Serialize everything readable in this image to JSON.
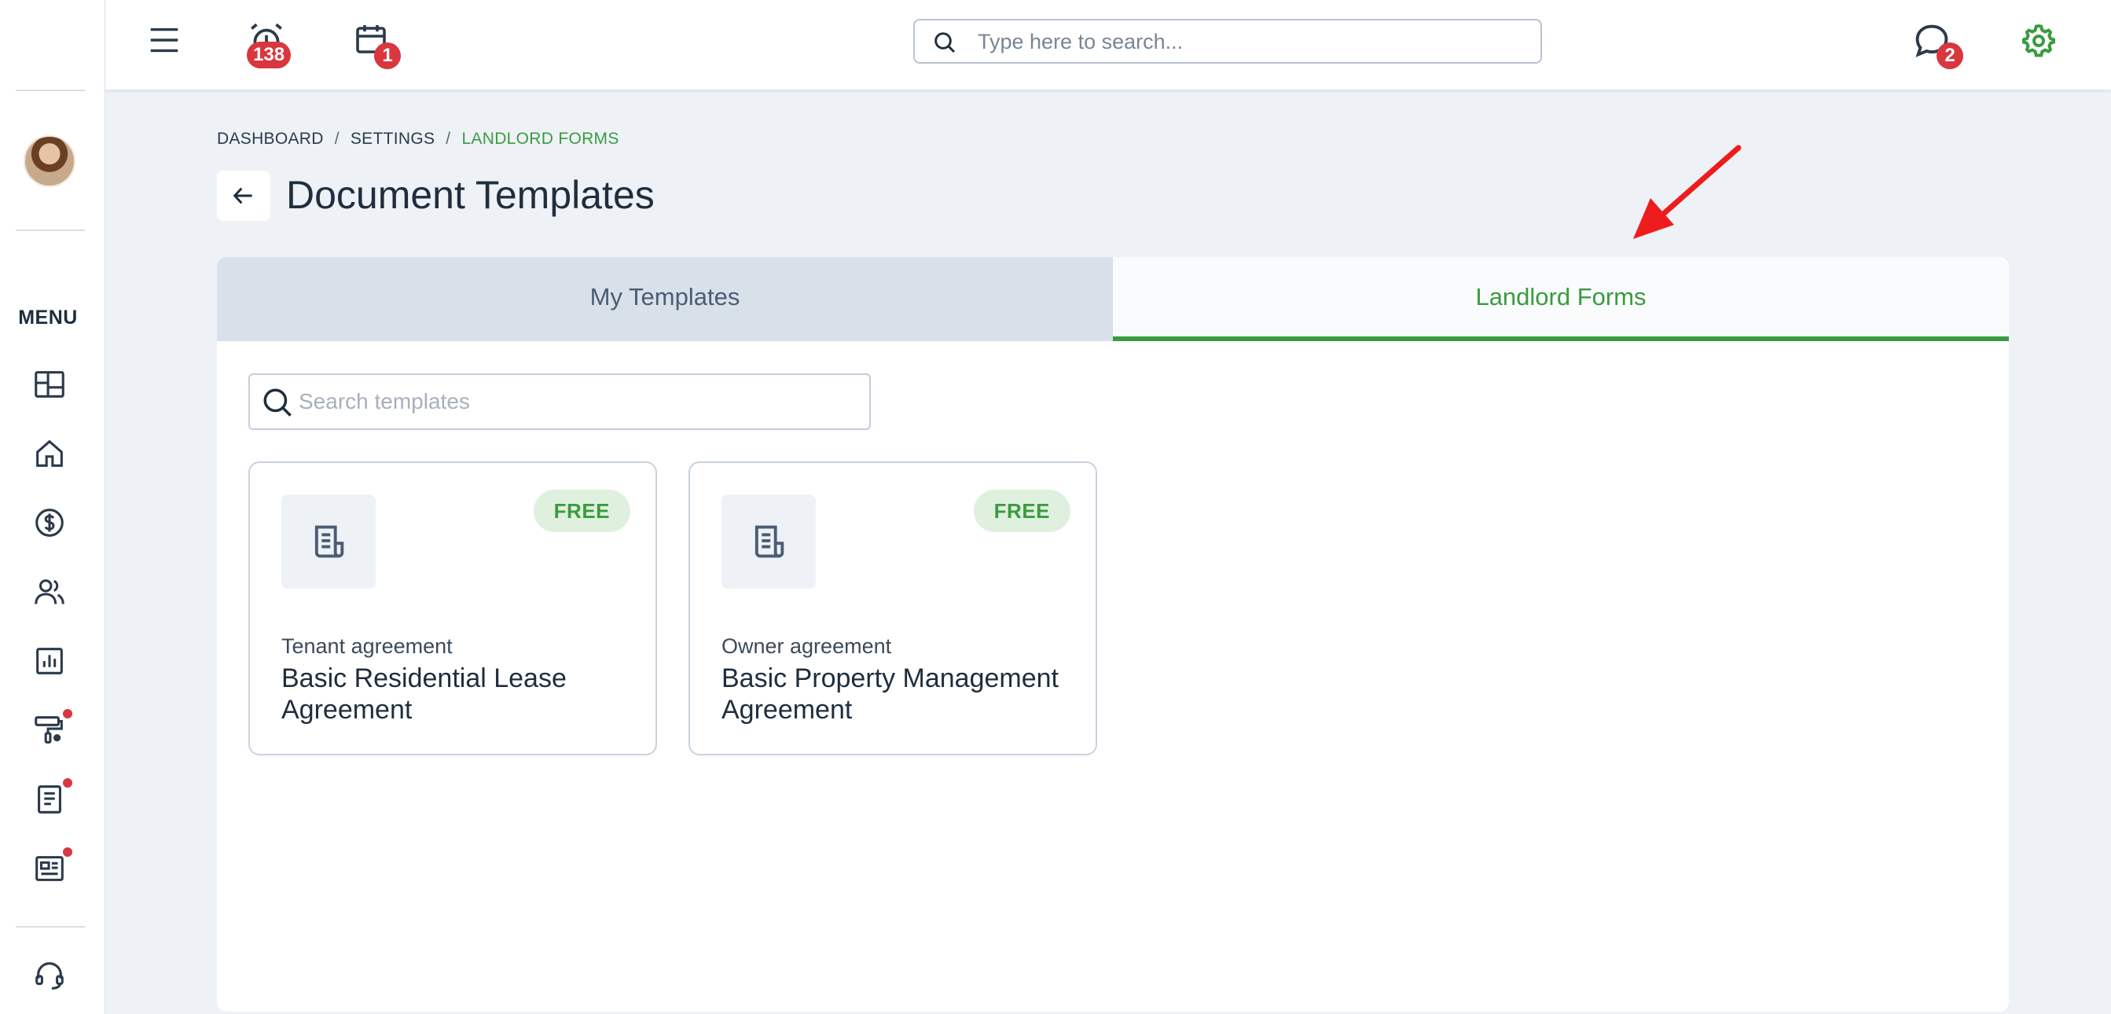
{
  "colors": {
    "accent_green": "#3a9b3f",
    "badge_red": "#d9363e",
    "text_dark": "#1f2d3d",
    "annotation_arrow": "#ee1c1c"
  },
  "sidebar": {
    "menu_label": "MENU",
    "items": [
      {
        "icon": "dashboard-icon",
        "has_dot": false
      },
      {
        "icon": "home-icon",
        "has_dot": false
      },
      {
        "icon": "dollar-icon",
        "has_dot": false
      },
      {
        "icon": "users-icon",
        "has_dot": false
      },
      {
        "icon": "reports-icon",
        "has_dot": true
      },
      {
        "icon": "paint-roller-icon",
        "has_dot": true
      },
      {
        "icon": "document-icon",
        "has_dot": true
      },
      {
        "icon": "newsletter-icon",
        "has_dot": true
      }
    ],
    "support_icon": "headset-icon"
  },
  "topbar": {
    "alarm_badge": "138",
    "calendar_badge": "1",
    "search_placeholder": "Type here to search...",
    "chat_badge": "2"
  },
  "breadcrumb": {
    "items": [
      "DASHBOARD",
      "SETTINGS",
      "LANDLORD FORMS"
    ],
    "separator": "/"
  },
  "page": {
    "title": "Document Templates"
  },
  "tabs": [
    {
      "label": "My Templates",
      "active": false
    },
    {
      "label": "Landlord Forms",
      "active": true
    }
  ],
  "templates_search": {
    "placeholder": "Search templates"
  },
  "templates": [
    {
      "badge": "FREE",
      "category": "Tenant agreement",
      "title": "Basic Residential Lease Agreement"
    },
    {
      "badge": "FREE",
      "category": "Owner agreement",
      "title": "Basic Property Management Agreement"
    }
  ]
}
